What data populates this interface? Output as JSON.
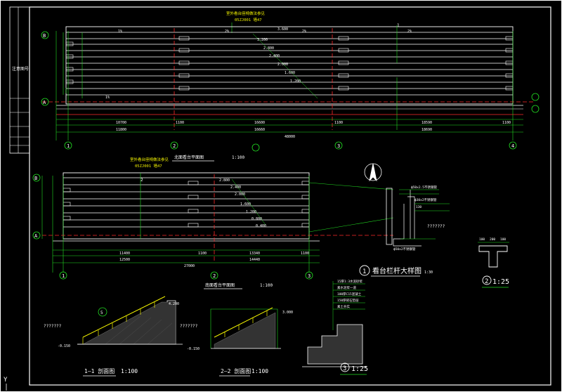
{
  "colors": {
    "background": "#000000",
    "frame": "#ffffff",
    "cyan": "#00e5e5",
    "green": "#22dd22",
    "yellow": "#f2f200",
    "red": "#ff2a2a",
    "white": "#ffffff",
    "magenta": "#ff40ff"
  },
  "plan_top": {
    "note_title": "室外看台座椅做法参见",
    "note_ref": "05ZJ001 墙47",
    "elevations": [
      "3.600",
      "3.200",
      "2.800",
      "2.400",
      "2.000",
      "1.600",
      "1.200"
    ],
    "axis_labels_left": [
      "B",
      "A"
    ],
    "axis_numbers": [
      "1",
      "2",
      "3",
      "4"
    ],
    "dims_row1": [
      "10700",
      "1100",
      "16600",
      "1100",
      "18590",
      "1100"
    ],
    "dims_row2": [
      "11800",
      "16660",
      "18690"
    ],
    "dims_total": "48000",
    "slope_marks": [
      "1%",
      "2%",
      "2%",
      "2%",
      "1%"
    ],
    "center_mark": "1"
  },
  "plan_bottom": {
    "note_title": "室外看台座椅做法参见",
    "note_ref": "05ZJ001 墙47",
    "title": "南面看台平面图",
    "scale": "1:100",
    "elevations": [
      "2.800",
      "2.400",
      "2.000",
      "1.600",
      "1.200",
      "0.800",
      "0.400"
    ],
    "axis_labels_left": [
      "B",
      "A"
    ],
    "axis_numbers": [
      "1",
      "2",
      "3"
    ],
    "dims_row1": [
      "11400",
      "1100",
      "13340",
      "1100"
    ],
    "dims_row2": [
      "12500",
      "14440"
    ],
    "dims_total": "27000",
    "center_mark": "2",
    "top_title": "北面看台平面图",
    "top_scale": "1:100"
  },
  "section_11": {
    "title": "1—1 剖面图",
    "scale": "1:100",
    "top_elev": "4.200",
    "base_elev": "-0.150",
    "mark": "5",
    "unknown_label": "???????"
  },
  "section_22": {
    "title": "2—2 剖面图",
    "scale": "1:100",
    "top_elev": "3.000",
    "base_elev": "-0.150",
    "unknown_label": "???????"
  },
  "detail_1": {
    "number": "1",
    "title": "看台栏杆大样图",
    "scale": "1:30",
    "label_top": "ϕ50x2.5不锈钢管",
    "label_mid": "ϕ30x2不锈钢管",
    "label_bot": "ϕ50x2不锈钢管",
    "unknown_label": "???????",
    "small_dim": "130"
  },
  "detail_2": {
    "number": "2",
    "scale": "1:25",
    "dims": [
      "100",
      "200",
      "100"
    ]
  },
  "detail_3": {
    "number": "3",
    "scale": "1:25",
    "notes": [
      "15厚1:3水泥砂浆",
      "素水泥浆一道",
      "100厚C15混凝土",
      "150厚碎石垫层",
      "素土夯实"
    ]
  },
  "titleblock": {
    "label_a": "注意",
    "label_b": "图号"
  },
  "ucs_icon": "Y"
}
